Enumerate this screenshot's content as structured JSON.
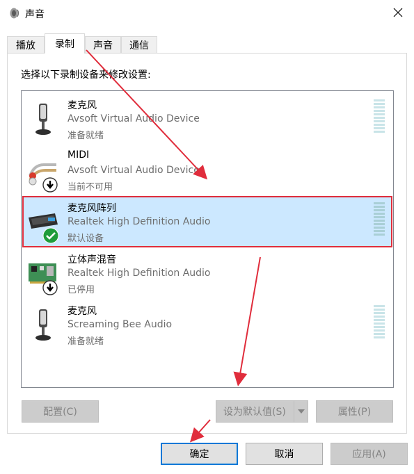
{
  "window": {
    "title": "声音",
    "icon": "speaker-icon",
    "close_icon": "close-icon"
  },
  "tabs": [
    {
      "label": "播放",
      "active": false
    },
    {
      "label": "录制",
      "active": true
    },
    {
      "label": "声音",
      "active": false
    },
    {
      "label": "通信",
      "active": false
    }
  ],
  "instruction": "选择以下录制设备来修改设置:",
  "devices": [
    {
      "name": "麦克风",
      "description": "Avsoft Virtual Audio Device",
      "status": "准备就绪",
      "icon": "microphone-icon",
      "badge": "",
      "selected": false,
      "level_meter": true
    },
    {
      "name": "MIDI",
      "description": "Avsoft Virtual Audio Device",
      "status": "当前不可用",
      "icon": "cable-connector-icon",
      "badge": "down-arrow-badge-icon",
      "selected": false,
      "level_meter": false
    },
    {
      "name": "麦克风阵列",
      "description": "Realtek High Definition Audio",
      "status": "默认设备",
      "icon": "webcam-mic-array-icon",
      "badge": "checkmark-badge-icon",
      "selected": true,
      "level_meter": true
    },
    {
      "name": "立体声混音",
      "description": "Realtek High Definition Audio",
      "status": "已停用",
      "icon": "sound-card-icon",
      "badge": "down-arrow-badge-icon",
      "selected": false,
      "level_meter": false
    },
    {
      "name": "麦克风",
      "description": "Screaming Bee Audio",
      "status": "准备就绪",
      "icon": "microphone-icon",
      "badge": "",
      "selected": false,
      "level_meter": true
    }
  ],
  "buttons": {
    "configure": "配置(C)",
    "set_default": "设为默认值(S)",
    "properties": "属性(P)",
    "ok": "确定",
    "cancel": "取消",
    "apply": "应用(A)"
  },
  "colors": {
    "selection": "#cce8ff",
    "annotation_red": "#e02d3c",
    "focus_blue": "#0078d7"
  }
}
